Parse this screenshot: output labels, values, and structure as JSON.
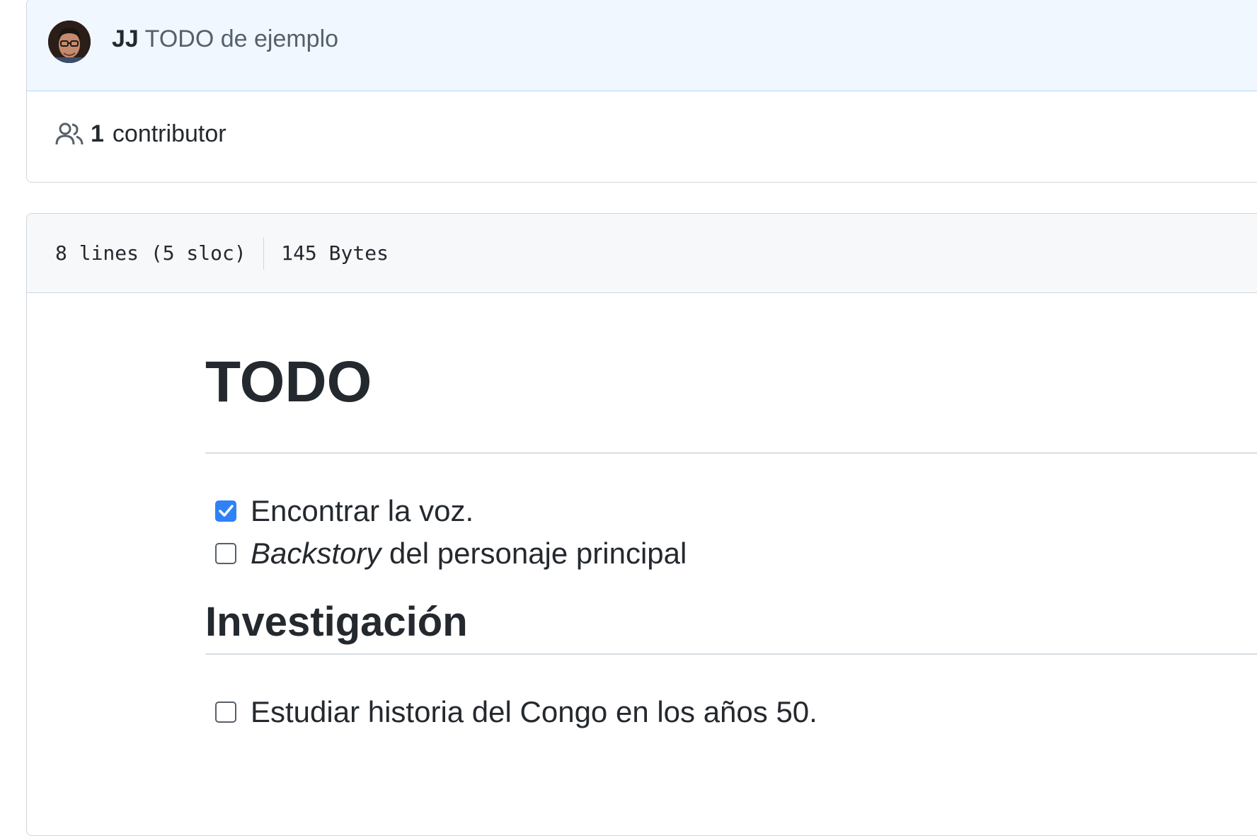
{
  "commit": {
    "author": "JJ",
    "message": "TODO de ejemplo",
    "avatar_icon": "user-avatar"
  },
  "contributors": {
    "count": "1",
    "label": "contributor",
    "icon": "people-icon"
  },
  "file": {
    "lines": "8 lines (5 sloc)",
    "size": "145 Bytes"
  },
  "markdown": {
    "h1": "TODO",
    "tasks_1": [
      {
        "emphasis": "",
        "text": "Encontrar la voz.",
        "checked": true
      },
      {
        "emphasis": "Backstory",
        "text": " del personaje principal",
        "checked": false
      }
    ],
    "h2": "Investigación",
    "tasks_2": [
      {
        "emphasis": "",
        "text": "Estudiar historia del Congo en los años 50.",
        "checked": false
      }
    ]
  },
  "colors": {
    "header_bg": "#f0f7ff",
    "checkbox_accent": "#2f81f7",
    "border": "#d0d7de"
  }
}
